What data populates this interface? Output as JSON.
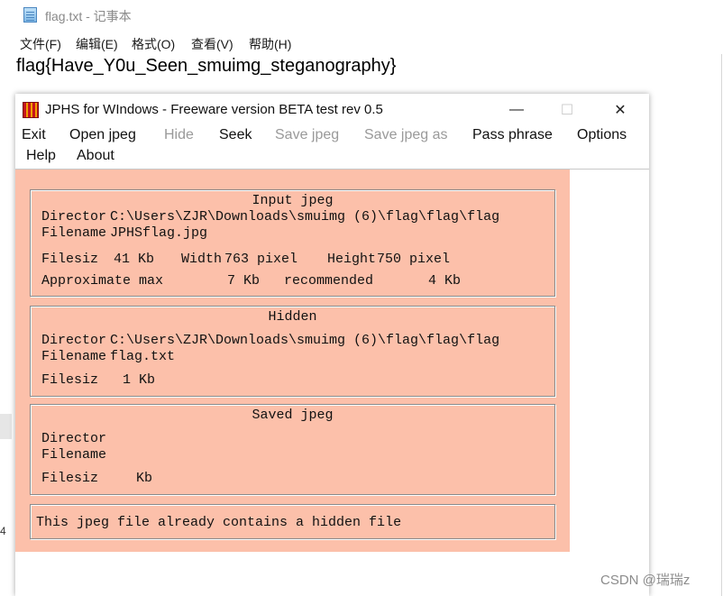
{
  "notepad": {
    "title": "flag.txt - 记事本",
    "menu": [
      "文件(F)",
      "编辑(E)",
      "格式(O)",
      "查看(V)",
      "帮助(H)"
    ],
    "content": "flag{Have_Y0u_Seen_smuimg_steganography}",
    "edge_char": "4"
  },
  "jphs": {
    "title": "JPHS for WIndows - Freeware version BETA test rev 0.5",
    "controls": {
      "minimize": "—",
      "maximize": "☐",
      "close": "✕"
    },
    "menu": {
      "exit": "Exit",
      "open_jpeg": "Open jpeg",
      "hide": "Hide",
      "seek": "Seek",
      "save_jpeg": "Save jpeg",
      "save_jpeg_as": "Save jpeg as",
      "pass_phrase": "Pass phrase",
      "options": "Options",
      "help": "Help",
      "about": "About"
    },
    "input": {
      "title": "Input jpeg",
      "dir_label": "Director",
      "dir_value": "C:\\Users\\ZJR\\Downloads\\smuimg (6)\\flag\\flag\\flag",
      "file_label": "Filename",
      "file_value": "JPHSflag.jpg",
      "size_label": "Filesiz",
      "size_value": "41 Kb",
      "width_label": "Width",
      "width_value": "763 pixel",
      "height_label": "Height",
      "height_value": "750 pixel",
      "approx_label": "Approximate max",
      "approx_value": "7 Kb",
      "rec_label": "recommended",
      "rec_value": "4 Kb"
    },
    "hidden": {
      "title": "Hidden",
      "dir_label": "Director",
      "dir_value": "C:\\Users\\ZJR\\Downloads\\smuimg (6)\\flag\\flag\\flag",
      "file_label": "Filename",
      "file_value": "flag.txt",
      "size_label": "Filesiz",
      "size_value": "1 Kb"
    },
    "saved": {
      "title": "Saved jpeg",
      "dir_label": "Director",
      "file_label": "Filename",
      "size_label": "Filesiz",
      "size_unit": "Kb"
    },
    "status": "This jpeg file already contains a hidden file",
    "client_color": "#fcc0aa"
  },
  "watermark": "CSDN @瑞瑞z"
}
